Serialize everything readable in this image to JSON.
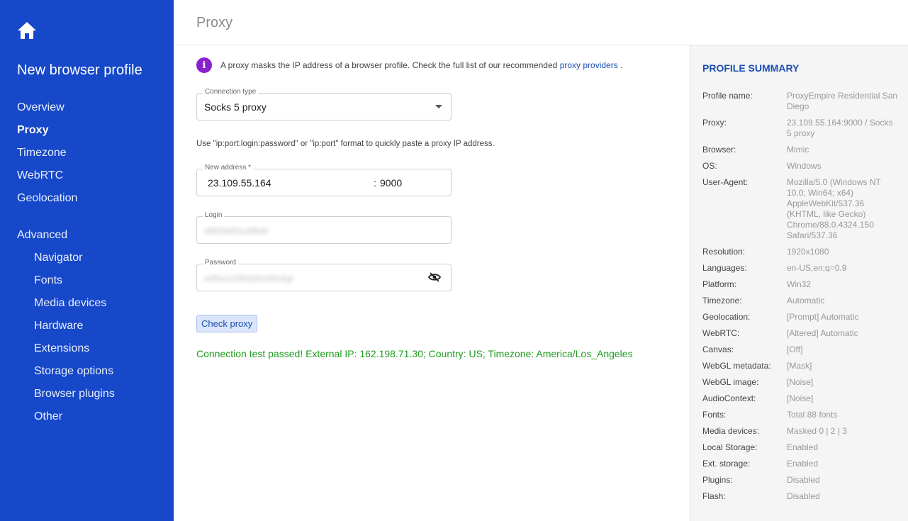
{
  "sidebar": {
    "title": "New browser profile",
    "items": [
      {
        "label": "Overview"
      },
      {
        "label": "Proxy"
      },
      {
        "label": "Timezone"
      },
      {
        "label": "WebRTC"
      },
      {
        "label": "Geolocation"
      },
      {
        "label": "Advanced"
      },
      {
        "label": "Navigator"
      },
      {
        "label": "Fonts"
      },
      {
        "label": "Media devices"
      },
      {
        "label": "Hardware"
      },
      {
        "label": "Extensions"
      },
      {
        "label": "Storage options"
      },
      {
        "label": "Browser plugins"
      },
      {
        "label": "Other"
      }
    ],
    "active": "Proxy"
  },
  "header": {
    "title": "Proxy"
  },
  "main": {
    "info_text": "A proxy masks the IP address of a browser profile. Check the full list of our recommended",
    "info_link": "proxy providers",
    "info_end": ".",
    "connection_type": {
      "label": "Connection type",
      "value": "Socks 5 proxy"
    },
    "hint": "Use \"ip:port:login:password\" or \"ip:port\" format to quickly paste a proxy IP address.",
    "address": {
      "label": "New address *",
      "ip": "23.109.55.164",
      "separator": ":",
      "port": "9000"
    },
    "login": {
      "label": "Login",
      "value": "af5f0fa0f1a4f6d0"
    },
    "password": {
      "label": "Password",
      "value": "e4f5a1c0f5fd2b2d0e6gr"
    },
    "check_button": "Check proxy",
    "status": "Connection test passed! External IP: 162.198.71.30; Country: US; Timezone: America/Los_Angeles"
  },
  "summary": {
    "title": "PROFILE SUMMARY",
    "rows": [
      {
        "key": "Profile name:",
        "value": "ProxyEmpire Residential San Diego"
      },
      {
        "key": "Proxy:",
        "value": "23.109.55.164:9000 / Socks 5 proxy"
      },
      {
        "key": "Browser:",
        "value": "Mimic"
      },
      {
        "key": "OS:",
        "value": "Windows"
      },
      {
        "key": "User-Agent:",
        "value": "Mozilla/5.0 (Windows NT 10.0; Win64; x64) AppleWebKit/537.36 (KHTML, like Gecko) Chrome/88.0.4324.150 Safari/537.36"
      },
      {
        "key": "Resolution:",
        "value": "1920x1080"
      },
      {
        "key": "Languages:",
        "value": "en-US,en;q=0.9"
      },
      {
        "key": "Platform:",
        "value": "Win32"
      },
      {
        "key": "Timezone:",
        "value": "Automatic"
      },
      {
        "key": "Geolocation:",
        "value": "[Prompt] Automatic"
      },
      {
        "key": "WebRTC:",
        "value": "[Altered] Automatic"
      },
      {
        "key": "Canvas:",
        "value": "[Off]"
      },
      {
        "key": "WebGL metadata:",
        "value": "[Mask]"
      },
      {
        "key": "WebGL image:",
        "value": "[Noise]"
      },
      {
        "key": "AudioContext:",
        "value": "[Noise]"
      },
      {
        "key": "Fonts:",
        "value": "Total 88 fonts"
      },
      {
        "key": "Media devices:",
        "value": "Masked 0 | 2 | 3"
      },
      {
        "key": "Local Storage:",
        "value": "Enabled"
      },
      {
        "key": "Ext. storage:",
        "value": "Enabled"
      },
      {
        "key": "Plugins:",
        "value": "Disabled"
      },
      {
        "key": "Flash:",
        "value": "Disabled"
      }
    ]
  },
  "colors": {
    "sidebar_bg": "#1748c9",
    "accent": "#1a4fb3",
    "success": "#1f9d1f",
    "info_icon": "#8a1fcf"
  }
}
